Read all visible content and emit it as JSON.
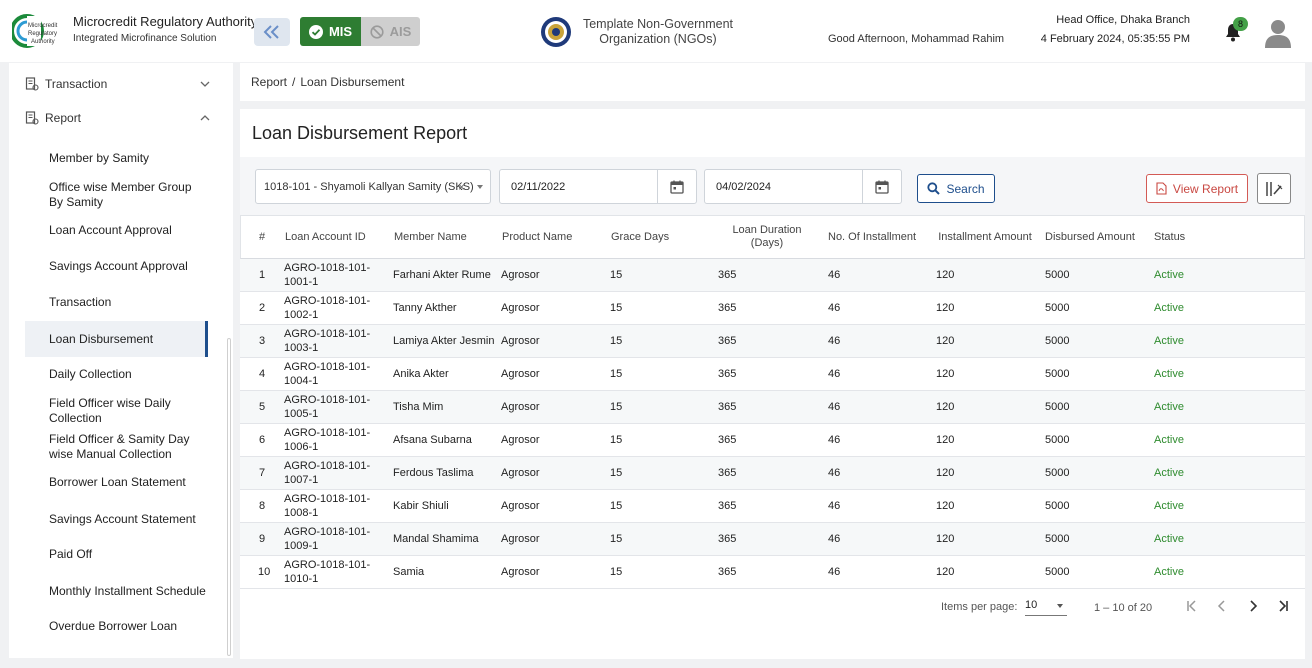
{
  "header": {
    "org_title": "Microcredit Regulatory Authority",
    "org_subtitle": "Integrated Microfinance Solution",
    "logo_text": "Microcredit Regulatory Authority",
    "mis_label": "MIS",
    "ais_label": "AIS",
    "ngo_name": "Template Non-Government Organization (NGOs)",
    "greeting": "Good Afternoon, Mohammad Rahim",
    "branch": "Head Office, Dhaka Branch",
    "datetime": "4 February 2024, 05:35:55 PM",
    "notification_count": "8",
    "accent_color": "#2e7d32",
    "primary_color": "#1e4e8c"
  },
  "sidebar": {
    "sections": [
      {
        "label": "Transaction",
        "icon": "report-icon",
        "expanded": false
      },
      {
        "label": "Report",
        "icon": "report-icon",
        "expanded": true
      }
    ],
    "report_items": [
      {
        "label": "Member by Samity"
      },
      {
        "label": "Office wise Member Group By Samity"
      },
      {
        "label": "Loan Account Approval"
      },
      {
        "label": "Savings Account Approval"
      },
      {
        "label": "Transaction"
      },
      {
        "label": "Loan Disbursement",
        "active": true
      },
      {
        "label": "Daily Collection"
      },
      {
        "label": "Field Officer wise Daily Collection"
      },
      {
        "label": "Field Officer & Samity Day wise Manual Collection"
      },
      {
        "label": "Borrower Loan Statement"
      },
      {
        "label": "Savings Account Statement"
      },
      {
        "label": "Paid Off"
      },
      {
        "label": "Monthly Installment Schedule"
      },
      {
        "label": "Overdue Borrower Loan"
      }
    ]
  },
  "breadcrumb": {
    "root": "Report",
    "separator": "/",
    "current": "Loan Disbursement"
  },
  "page": {
    "title": "Loan Disbursement Report"
  },
  "filters": {
    "samity": "1018-101 - Shyamoli Kallyan Samity (SKS)",
    "clear_symbol": "×",
    "from_date": "02/11/2022",
    "to_date": "04/02/2024",
    "search_label": "Search",
    "view_report_label": "View Report"
  },
  "table": {
    "columns": [
      "#",
      "Loan Account ID",
      "Member Name",
      "Product Name",
      "Grace Days",
      "Loan Duration (Days)",
      "No. Of Installment",
      "Installment Amount",
      "Disbursed Amount",
      "Status"
    ],
    "rows": [
      [
        "1",
        "AGRO-1018-101-1001-1",
        "Farhani Akter Rume",
        "Agrosor",
        "15",
        "365",
        "46",
        "120",
        "5000",
        "Active"
      ],
      [
        "2",
        "AGRO-1018-101-1002-1",
        "Tanny Akther",
        "Agrosor",
        "15",
        "365",
        "46",
        "120",
        "5000",
        "Active"
      ],
      [
        "3",
        "AGRO-1018-101-1003-1",
        "Lamiya Akter Jesmin",
        "Agrosor",
        "15",
        "365",
        "46",
        "120",
        "5000",
        "Active"
      ],
      [
        "4",
        "AGRO-1018-101-1004-1",
        "Anika Akter",
        "Agrosor",
        "15",
        "365",
        "46",
        "120",
        "5000",
        "Active"
      ],
      [
        "5",
        "AGRO-1018-101-1005-1",
        "Tisha Mim",
        "Agrosor",
        "15",
        "365",
        "46",
        "120",
        "5000",
        "Active"
      ],
      [
        "6",
        "AGRO-1018-101-1006-1",
        "Afsana Subarna",
        "Agrosor",
        "15",
        "365",
        "46",
        "120",
        "5000",
        "Active"
      ],
      [
        "7",
        "AGRO-1018-101-1007-1",
        "Ferdous Taslima",
        "Agrosor",
        "15",
        "365",
        "46",
        "120",
        "5000",
        "Active"
      ],
      [
        "8",
        "AGRO-1018-101-1008-1",
        "Kabir Shiuli",
        "Agrosor",
        "15",
        "365",
        "46",
        "120",
        "5000",
        "Active"
      ],
      [
        "9",
        "AGRO-1018-101-1009-1",
        "Mandal Shamima",
        "Agrosor",
        "15",
        "365",
        "46",
        "120",
        "5000",
        "Active"
      ],
      [
        "10",
        "AGRO-1018-101-1010-1",
        "Samia",
        "Agrosor",
        "15",
        "365",
        "46",
        "120",
        "5000",
        "Active"
      ]
    ],
    "status_color": "#2e8b2e"
  },
  "pagination": {
    "items_per_page_label": "Items per page:",
    "items_per_page": "10",
    "range": "1 – 10 of 20"
  }
}
